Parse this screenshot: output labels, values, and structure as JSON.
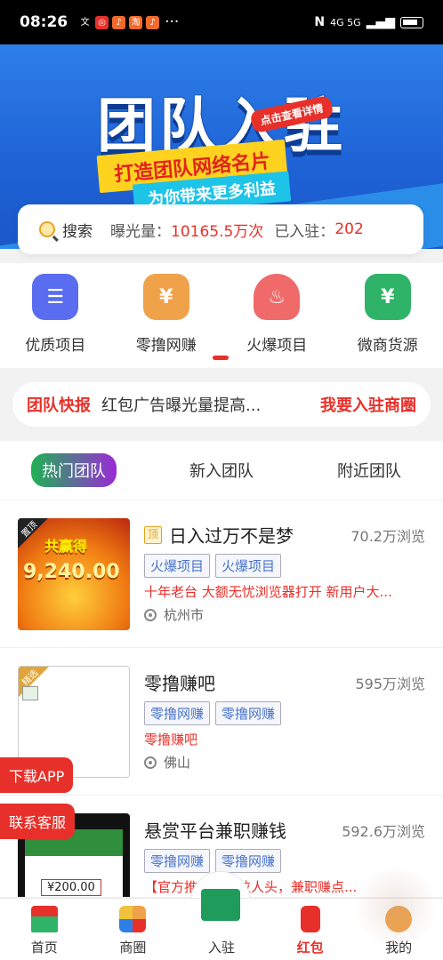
{
  "status_bar": {
    "time": "08:26",
    "network": "4G 5G"
  },
  "banner": {
    "title": "团队入驻",
    "subtitle1": "打造团队网络名片",
    "subtitle2": "为你带来更多利益",
    "tag": "点击查看详情"
  },
  "search": {
    "label": "搜索",
    "exposure_label": "曝光量：",
    "exposure_value": "10165.5万次",
    "joined_label": "已入驻：",
    "joined_value": "202"
  },
  "categories": [
    {
      "label": "优质项目",
      "icon": "document-search-icon",
      "color": "#5a6cf0"
    },
    {
      "label": "零撸网赚",
      "icon": "money-bag-icon",
      "color": "#f0a24a"
    },
    {
      "label": "火爆项目",
      "icon": "flame-icon",
      "color": "#f06a6a"
    },
    {
      "label": "微商货源",
      "icon": "coin-bag-icon",
      "color": "#2fb368"
    }
  ],
  "ticker": {
    "title": "团队快报",
    "text": "红包广告曝光量提高...",
    "cta": "我要入驻商圈"
  },
  "tabs": [
    {
      "label": "热门团队",
      "active": true
    },
    {
      "label": "新入团队",
      "active": false
    },
    {
      "label": "附近团队",
      "active": false
    }
  ],
  "items": [
    {
      "corner": "置顶",
      "thumb_big": "9,240.00",
      "thumb_sub": "共赢得",
      "top_badge": "顶",
      "title": "日入过万不是梦",
      "views": "70.2万浏览",
      "tags": [
        "火爆项目",
        "火爆项目"
      ],
      "desc": "十年老台 大额无忧浏览器打开 新用户大...",
      "location": "杭州市"
    },
    {
      "corner": "精选",
      "title": "零撸赚吧",
      "views": "595万浏览",
      "tags": [
        "零撸网赚",
        "零撸网赚"
      ],
      "desc": "零撸赚吧",
      "location": "佛山"
    },
    {
      "corner": "",
      "thumb_amount": "¥200.00",
      "title": "悬赏平台兼职赚钱",
      "views": "592.6万浏览",
      "tags": [
        "零撸网赚",
        "零撸网赚"
      ],
      "desc": "【官方推广项目拉人头，兼职赚点..."
    }
  ],
  "float_buttons": {
    "download": "下载APP",
    "service": "联系客服"
  },
  "bottom_nav": [
    {
      "label": "首页",
      "icon": "home-icon"
    },
    {
      "label": "商圈",
      "icon": "grid-icon"
    },
    {
      "label": "入驻",
      "icon": "pencil-icon"
    },
    {
      "label": "红包",
      "icon": "red-packet-icon",
      "active": true
    },
    {
      "label": "我的",
      "icon": "user-icon"
    }
  ]
}
